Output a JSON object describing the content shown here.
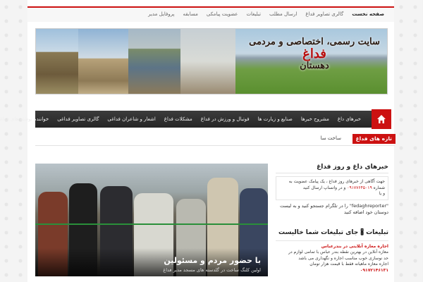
{
  "topnav": [
    "صفحه نخست",
    "گالری تصاویر فداغ",
    "ارسال مطلب",
    "تبلیغات",
    "عضویت پیامکی",
    "مسابقه",
    "پروفایل مدیر"
  ],
  "banner": {
    "title_line1": "سایت رسمی، اختصاصی و مردمی",
    "title_brand": "فداغ",
    "title_line2": "دهستان"
  },
  "mainnav": [
    "خبرهای داغ",
    "مشروح خبرها",
    "صنایع و زیارت ها",
    "فوتبال و ورزش در فداغ",
    "مشکلات فداغ",
    "اشعار و شاعران فداغی",
    "گالری تصاویر فداغی",
    "خواننده نوشته های فداغی"
  ],
  "ticker": {
    "label": "تازه های فداغ",
    "text": "ساخت سا"
  },
  "slider": {
    "title": "با حضور مردم و مسئولین",
    "subtitle": "اولین کلنگ ساخت در گلدسته های مسجد مدیر فداغ"
  },
  "sidebar": {
    "news_title": "خبرهای داغ و روز فداغ",
    "news_text1": "جهت آگاهی از خبرهای روز فداغ ، یک پیامک عضویت به شماره",
    "news_number": "۰۹۱۷۷۶۴۵۰۱۹",
    "news_text2": "و در واتساپ ارسال کنید",
    "news_text3": "و یا",
    "twitter_text": "\"fedaghreporter\" را در تلگرام جستجو کنید و به لیست دوستان خود اضافه کنید",
    "twitter_handle": "fedaghreporter",
    "ad_title": "تبلیغات 🖁 جای تبلیغات شما خالیست",
    "ad_company": "اجاره معازه آنلاینی در بندرعباس",
    "ad_line1": "معازه آنلاین در بهترین نقطه بندر عباس با تمامی لوازم در",
    "ad_line2": "حد نوسازی خوب مناسب اجاره و نگهداری می باشد",
    "ad_line3": "اجاره معازه ماهیانه فقط با قیمت هزار تومان",
    "ad_phone": "۰۹۱۷۲۱۴۶۱۳۱"
  },
  "colors": {
    "accent": "#cc1111",
    "nav_bg": "#2f2f2f"
  }
}
